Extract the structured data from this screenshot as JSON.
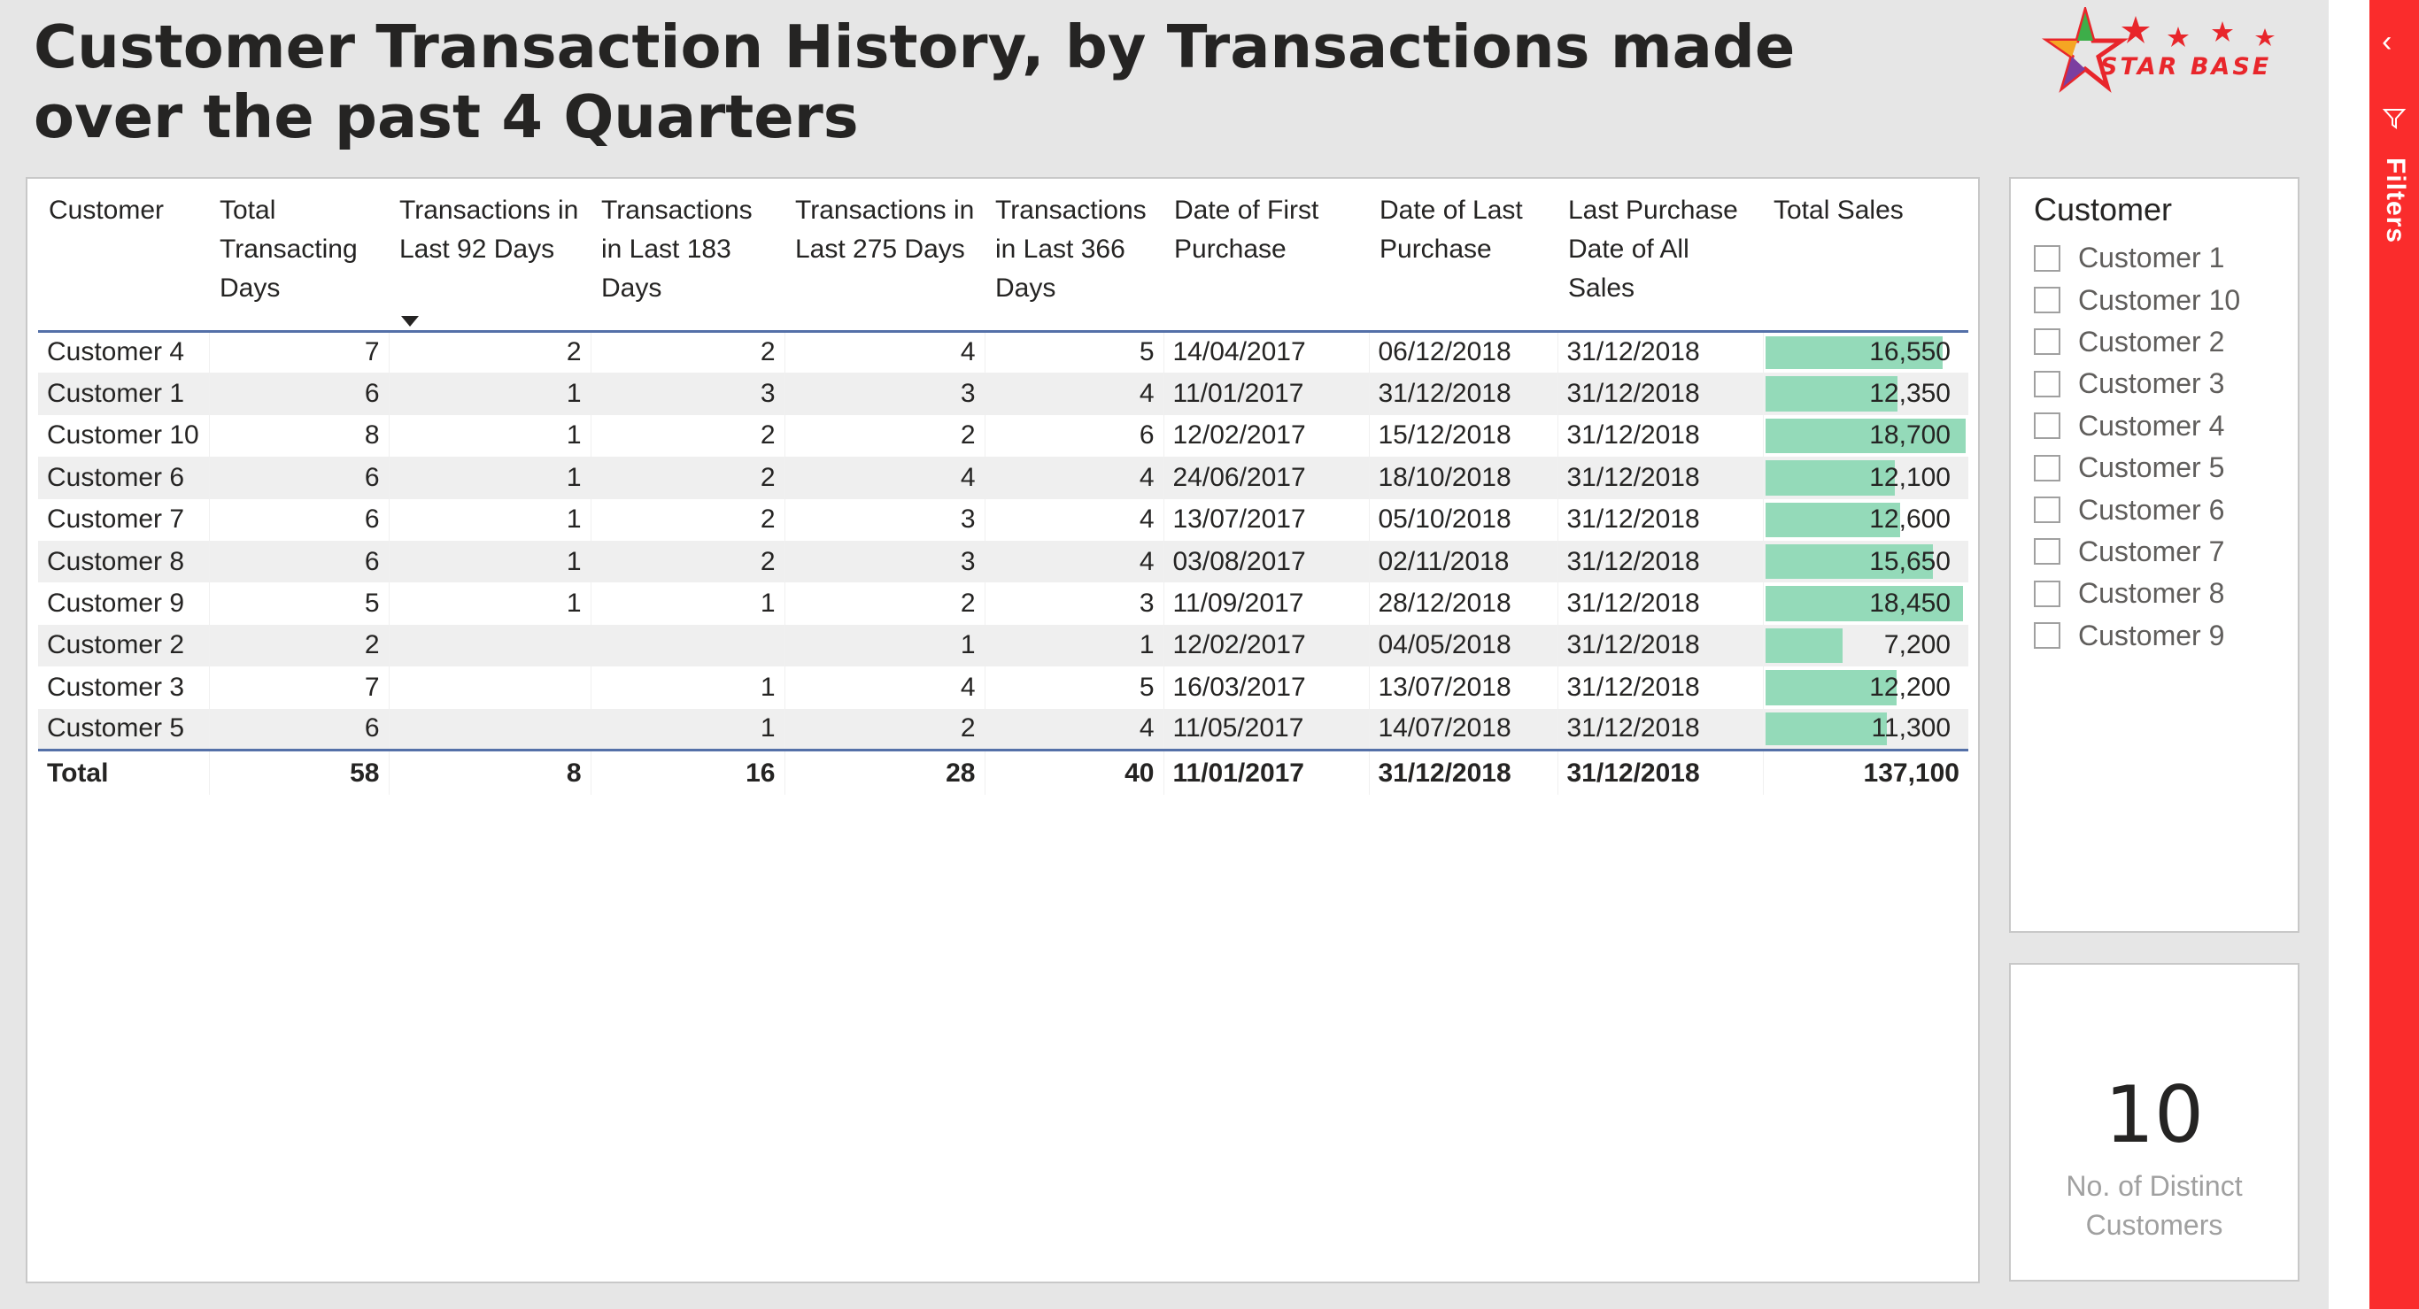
{
  "page": {
    "title_line1": "Customer Transaction History, by Transactions made",
    "title_line2": "over the past 4 Quarters"
  },
  "logo": {
    "text": "STAR BASE"
  },
  "table": {
    "columns": [
      {
        "key": "customer",
        "label": "Customer",
        "align": "left"
      },
      {
        "key": "total_days",
        "label": "Total Transacting Days",
        "align": "right"
      },
      {
        "key": "t92",
        "label": "Transactions in Last 92 Days",
        "align": "right",
        "sorted": "desc"
      },
      {
        "key": "t183",
        "label": "Transactions in Last 183 Days",
        "align": "right"
      },
      {
        "key": "t275",
        "label": "Transactions in Last 275 Days",
        "align": "right"
      },
      {
        "key": "t366",
        "label": "Transactions in Last 366 Days",
        "align": "right"
      },
      {
        "key": "first",
        "label": "Date of First Purchase",
        "align": "left"
      },
      {
        "key": "last",
        "label": "Date of Last Purchase",
        "align": "left"
      },
      {
        "key": "last_all",
        "label": "Last Purchase Date of All Sales",
        "align": "left"
      },
      {
        "key": "sales",
        "label": "Total Sales",
        "align": "right"
      }
    ],
    "rows": [
      {
        "customer": "Customer 4",
        "total_days": "7",
        "t92": "2",
        "t183": "2",
        "t275": "4",
        "t366": "5",
        "first": "14/04/2017",
        "last": "06/12/2018",
        "last_all": "31/12/2018",
        "sales": "16,550",
        "sales_value": 16550
      },
      {
        "customer": "Customer 1",
        "total_days": "6",
        "t92": "1",
        "t183": "3",
        "t275": "3",
        "t366": "4",
        "first": "11/01/2017",
        "last": "31/12/2018",
        "last_all": "31/12/2018",
        "sales": "12,350",
        "sales_value": 12350
      },
      {
        "customer": "Customer 10",
        "total_days": "8",
        "t92": "1",
        "t183": "2",
        "t275": "2",
        "t366": "6",
        "first": "12/02/2017",
        "last": "15/12/2018",
        "last_all": "31/12/2018",
        "sales": "18,700",
        "sales_value": 18700
      },
      {
        "customer": "Customer 6",
        "total_days": "6",
        "t92": "1",
        "t183": "2",
        "t275": "4",
        "t366": "4",
        "first": "24/06/2017",
        "last": "18/10/2018",
        "last_all": "31/12/2018",
        "sales": "12,100",
        "sales_value": 12100
      },
      {
        "customer": "Customer 7",
        "total_days": "6",
        "t92": "1",
        "t183": "2",
        "t275": "3",
        "t366": "4",
        "first": "13/07/2017",
        "last": "05/10/2018",
        "last_all": "31/12/2018",
        "sales": "12,600",
        "sales_value": 12600
      },
      {
        "customer": "Customer 8",
        "total_days": "6",
        "t92": "1",
        "t183": "2",
        "t275": "3",
        "t366": "4",
        "first": "03/08/2017",
        "last": "02/11/2018",
        "last_all": "31/12/2018",
        "sales": "15,650",
        "sales_value": 15650
      },
      {
        "customer": "Customer 9",
        "total_days": "5",
        "t92": "1",
        "t183": "1",
        "t275": "2",
        "t366": "3",
        "first": "11/09/2017",
        "last": "28/12/2018",
        "last_all": "31/12/2018",
        "sales": "18,450",
        "sales_value": 18450
      },
      {
        "customer": "Customer 2",
        "total_days": "2",
        "t92": "",
        "t183": "",
        "t275": "1",
        "t366": "1",
        "first": "12/02/2017",
        "last": "04/05/2018",
        "last_all": "31/12/2018",
        "sales": "7,200",
        "sales_value": 7200
      },
      {
        "customer": "Customer 3",
        "total_days": "7",
        "t92": "",
        "t183": "1",
        "t275": "4",
        "t366": "5",
        "first": "16/03/2017",
        "last": "13/07/2018",
        "last_all": "31/12/2018",
        "sales": "12,200",
        "sales_value": 12200
      },
      {
        "customer": "Customer 5",
        "total_days": "6",
        "t92": "",
        "t183": "1",
        "t275": "2",
        "t366": "4",
        "first": "11/05/2017",
        "last": "14/07/2018",
        "last_all": "31/12/2018",
        "sales": "11,300",
        "sales_value": 11300
      }
    ],
    "total": {
      "customer": "Total",
      "total_days": "58",
      "t92": "8",
      "t183": "16",
      "t275": "28",
      "t366": "40",
      "first": "11/01/2017",
      "last": "31/12/2018",
      "last_all": "31/12/2018",
      "sales": "137,100"
    },
    "bar_color": "#94dab9",
    "bar_max": 18700
  },
  "slicer": {
    "title": "Customer",
    "items": [
      "Customer 1",
      "Customer 10",
      "Customer 2",
      "Customer 3",
      "Customer 4",
      "Customer 5",
      "Customer 6",
      "Customer 7",
      "Customer 8",
      "Customer 9"
    ]
  },
  "card": {
    "value": "10",
    "label_line1": "No. of Distinct",
    "label_line2": "Customers"
  },
  "filters_pane": {
    "label": "Filters",
    "color": "#fa2c2c"
  }
}
